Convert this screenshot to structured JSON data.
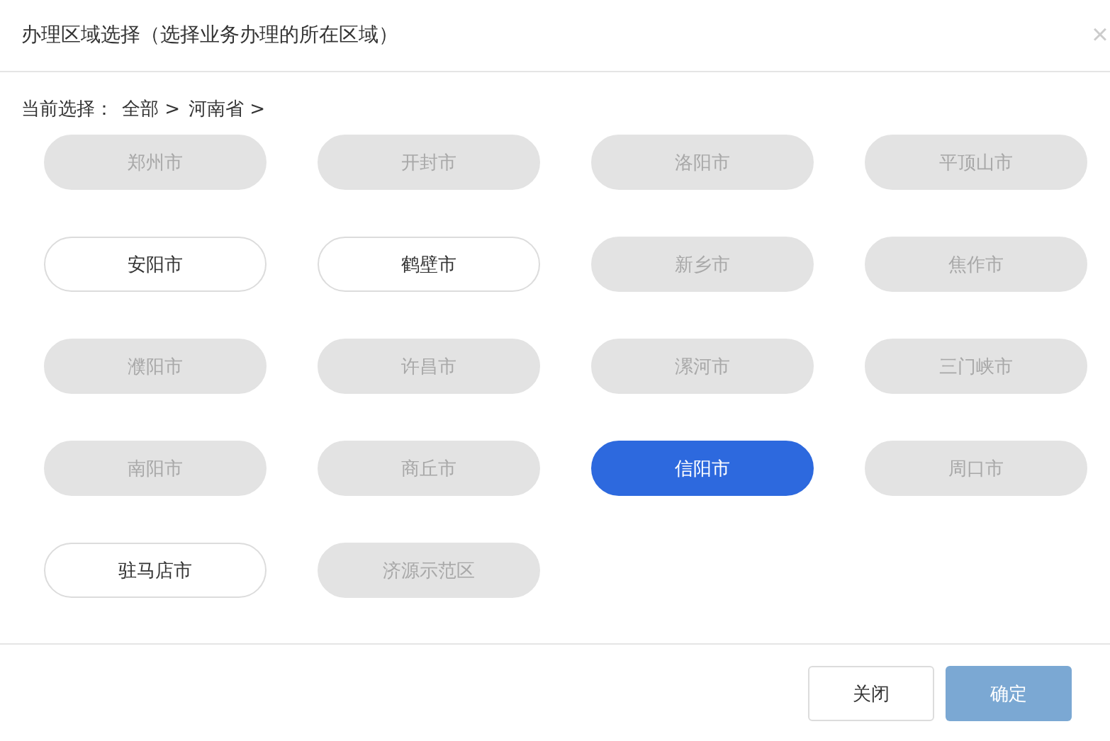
{
  "dialog": {
    "title": "办理区域选择（选择业务办理的所在区域）",
    "close": "×"
  },
  "breadcrumb": {
    "label": "当前选择：",
    "items": [
      "全部 >",
      "河南省 >"
    ]
  },
  "regions": [
    {
      "label": "郑州市",
      "disabled": true,
      "selected": false
    },
    {
      "label": "开封市",
      "disabled": true,
      "selected": false
    },
    {
      "label": "洛阳市",
      "disabled": true,
      "selected": false
    },
    {
      "label": "平顶山市",
      "disabled": true,
      "selected": false
    },
    {
      "label": "安阳市",
      "disabled": false,
      "selected": false
    },
    {
      "label": "鹤壁市",
      "disabled": false,
      "selected": false
    },
    {
      "label": "新乡市",
      "disabled": true,
      "selected": false
    },
    {
      "label": "焦作市",
      "disabled": true,
      "selected": false
    },
    {
      "label": "濮阳市",
      "disabled": true,
      "selected": false
    },
    {
      "label": "许昌市",
      "disabled": true,
      "selected": false
    },
    {
      "label": "漯河市",
      "disabled": true,
      "selected": false
    },
    {
      "label": "三门峡市",
      "disabled": true,
      "selected": false
    },
    {
      "label": "南阳市",
      "disabled": true,
      "selected": false
    },
    {
      "label": "商丘市",
      "disabled": true,
      "selected": false
    },
    {
      "label": "信阳市",
      "disabled": false,
      "selected": true
    },
    {
      "label": "周口市",
      "disabled": true,
      "selected": false
    },
    {
      "label": "驻马店市",
      "disabled": false,
      "selected": false
    },
    {
      "label": "济源示范区",
      "disabled": true,
      "selected": false
    }
  ],
  "buttons": [
    {
      "label": "关闭",
      "kind": "secondary",
      "disabled": false
    },
    {
      "label": "确定",
      "kind": "primary",
      "disabled": true
    }
  ]
}
